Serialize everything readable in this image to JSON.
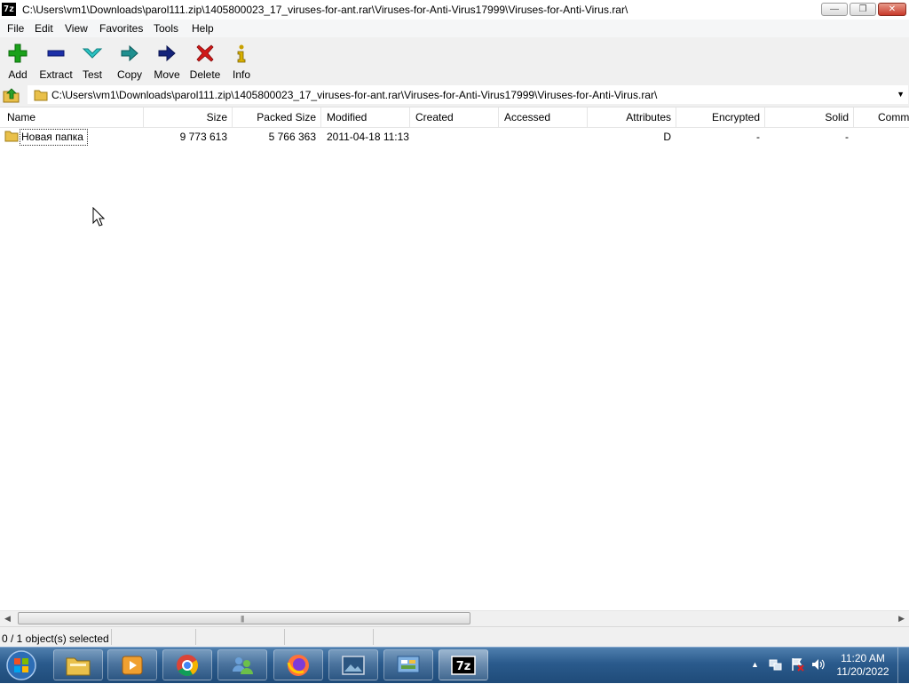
{
  "window": {
    "title": "C:\\Users\\vm1\\Downloads\\parol111.zip\\1405800023_17_viruses-for-ant.rar\\Viruses-for-Anti-Virus17999\\Viruses-for-Anti-Virus.rar\\",
    "app_icon_text": "7z",
    "min_glyph": "—",
    "max_glyph": "❐",
    "close_glyph": "✕"
  },
  "menu": {
    "items": [
      "File",
      "Edit",
      "View",
      "Favorites",
      "Tools",
      "Help"
    ]
  },
  "toolbar": {
    "buttons": [
      {
        "label": "Add",
        "icon": "plus-icon"
      },
      {
        "label": "Extract",
        "icon": "minus-icon"
      },
      {
        "label": "Test",
        "icon": "check-arrow-icon"
      },
      {
        "label": "Copy",
        "icon": "copy-arrow-icon"
      },
      {
        "label": "Move",
        "icon": "move-arrow-icon"
      },
      {
        "label": "Delete",
        "icon": "delete-x-icon"
      },
      {
        "label": "Info",
        "icon": "info-icon"
      }
    ]
  },
  "address": {
    "path": "C:\\Users\\vm1\\Downloads\\parol111.zip\\1405800023_17_viruses-for-ant.rar\\Viruses-for-Anti-Virus17999\\Viruses-for-Anti-Virus.rar\\",
    "dropdown_glyph": "▼"
  },
  "list": {
    "columns": [
      "Name",
      "Size",
      "Packed Size",
      "Modified",
      "Created",
      "Accessed",
      "Attributes",
      "Encrypted",
      "Solid",
      "Comm"
    ],
    "rows": [
      {
        "name": "Новая папка",
        "size": "9 773 613",
        "packed_size": "5 766 363",
        "modified": "2011-04-18 11:13",
        "created": "",
        "accessed": "",
        "attributes": "D",
        "encrypted": "-",
        "solid": "-",
        "comment": ""
      }
    ]
  },
  "scrollbar": {
    "left_arrow": "◀",
    "right_arrow": "▶",
    "grip": "|||"
  },
  "status": {
    "selection": "0 / 1 object(s) selected"
  },
  "taskbar": {
    "apps": [
      "explorer",
      "media-player",
      "chrome",
      "network-users",
      "firefox",
      "photo-viewer",
      "control-panel",
      "7-zip"
    ],
    "active_app": "7-zip",
    "app_7zip_label": "7z",
    "tray_arrow": "▲",
    "time": "11:20 AM",
    "date": "11/20/2022"
  }
}
